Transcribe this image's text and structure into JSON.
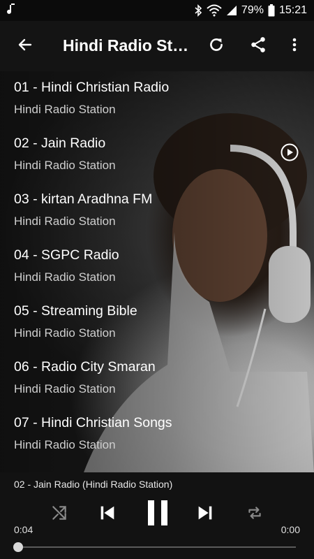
{
  "status_bar": {
    "left_icon": "music-note-icon",
    "battery": "79%",
    "time": "15:21"
  },
  "toolbar": {
    "title": "Hindi Radio Stations"
  },
  "stations": [
    {
      "title": "01 - Hindi Christian Radio",
      "subtitle": "Hindi Radio Station"
    },
    {
      "title": "02 - Jain Radio",
      "subtitle": "Hindi Radio Station"
    },
    {
      "title": "03 - kirtan Aradhna FM",
      "subtitle": "Hindi Radio Station"
    },
    {
      "title": "04 - SGPC Radio",
      "subtitle": "Hindi Radio Station"
    },
    {
      "title": "05 - Streaming Bible",
      "subtitle": "Hindi Radio Station"
    },
    {
      "title": "06 - Radio City Smaran",
      "subtitle": "Hindi Radio Station"
    },
    {
      "title": "07 - Hindi Christian Songs",
      "subtitle": "Hindi Radio Station"
    }
  ],
  "player": {
    "now_playing": "02 - Jain Radio (Hindi Radio Station)",
    "elapsed": "0:04",
    "remaining": "0:00",
    "progress": 0.0
  },
  "colors": {
    "toolbar": "#141414",
    "player": "#121212",
    "text": "#ffffff",
    "subtext": "#cfcfcf"
  }
}
